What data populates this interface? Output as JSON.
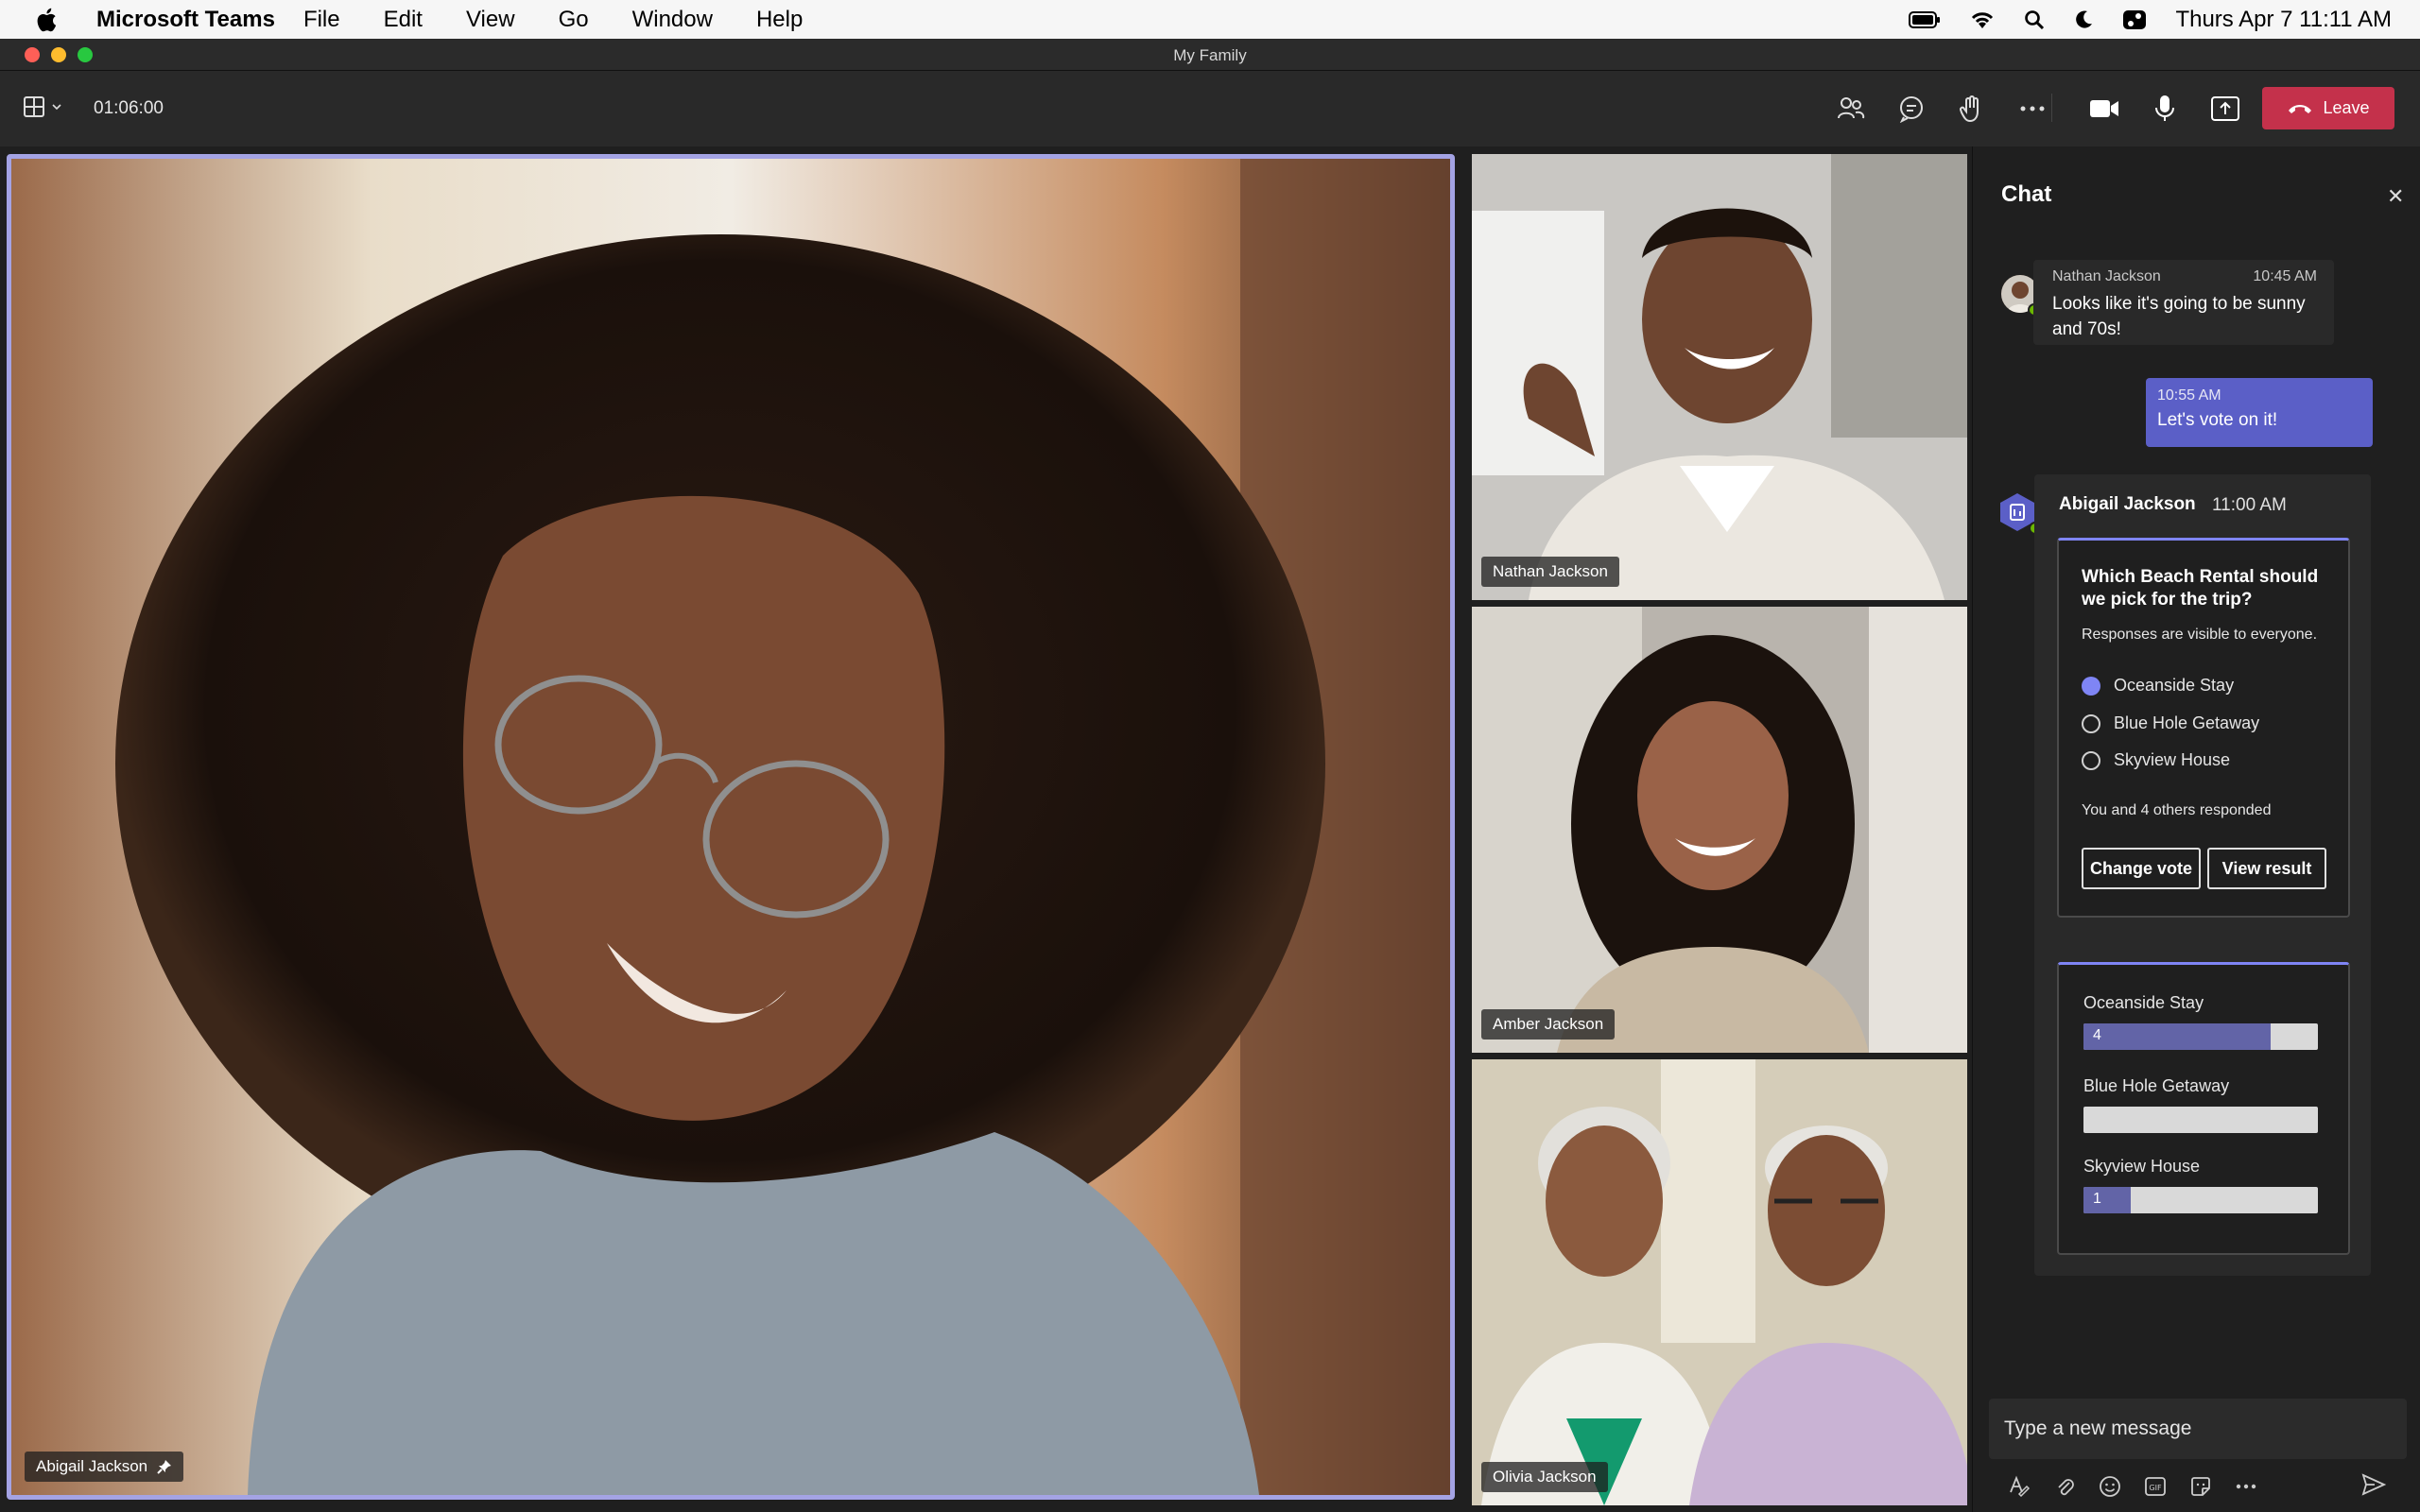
{
  "menubar": {
    "app_name": "Microsoft Teams",
    "menus": [
      "File",
      "Edit",
      "View",
      "Go",
      "Window",
      "Help"
    ],
    "clock": "Thurs Apr 7  11:11 AM"
  },
  "window": {
    "title": "My Family"
  },
  "toolbar": {
    "timer": "01:06:00",
    "leave_label": "Leave",
    "leave_color": "#c4314b"
  },
  "participants": {
    "main": {
      "name": "Abigail Jackson"
    },
    "tiles": [
      {
        "name": "Nathan Jackson"
      },
      {
        "name": "Amber Jackson"
      },
      {
        "name": "Olivia Jackson"
      }
    ]
  },
  "chat": {
    "title": "Chat",
    "messages": [
      {
        "sender": "Nathan Jackson",
        "time": "10:45 AM",
        "text": "Looks like it's going to be sunny and 70s!"
      },
      {
        "time": "10:55 AM",
        "text": "Let's vote on it!"
      }
    ],
    "poll": {
      "sender": "Abigail Jackson",
      "time": "11:00 AM",
      "question": "Which Beach Rental should we pick for the trip?",
      "note": "Responses are visible to everyone.",
      "options": [
        "Oceanside Stay",
        "Blue Hole Getaway",
        "Skyview House"
      ],
      "selected_option": "Oceanside Stay",
      "responded": "You and 4 others responded",
      "change_vote_label": "Change vote",
      "view_result_label": "View result",
      "accent": "#7f85f5"
    },
    "results": [
      {
        "label": "Oceanside Stay",
        "count": "4",
        "fraction": 0.8
      },
      {
        "label": "Blue Hole Getaway",
        "count": "",
        "fraction": 0
      },
      {
        "label": "Skyview House",
        "count": "1",
        "fraction": 0.2
      }
    ],
    "compose_placeholder": "Type a new message"
  }
}
